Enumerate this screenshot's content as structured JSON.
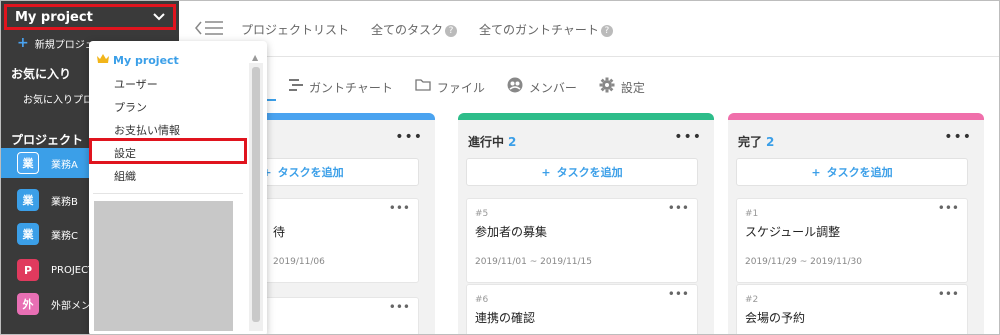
{
  "sidebar": {
    "project_title": "My project",
    "new_project_label": "新規プロジェ",
    "favorites_label": "お気に入り",
    "favorite_item": "お気に入りプロジ",
    "projects_label": "プロジェクト",
    "projects": [
      {
        "badge": "業",
        "name": "業務A",
        "color": "#3b9fe8"
      },
      {
        "badge": "業",
        "name": "業務B",
        "color": "#3b9fe8"
      },
      {
        "badge": "業",
        "name": "業務C",
        "color": "#3b9fe8"
      },
      {
        "badge": "P",
        "name": "PROJECT@",
        "color": "#e03a5e"
      },
      {
        "badge": "外",
        "name": "外部メンバ",
        "color": "#e86fb4"
      }
    ]
  },
  "topbar": {
    "nav": [
      "プロジェクトリスト",
      "全てのタスク",
      "全てのガントチャート"
    ]
  },
  "subtabs": [
    "ガントチャート",
    "ファイル",
    "メンバー",
    "設定"
  ],
  "dropdown": {
    "header": "My project",
    "items": [
      "ユーザー",
      "プラン",
      "お支払い情報",
      "設定",
      "組織"
    ]
  },
  "board": {
    "add_label": "タスクを追加",
    "columns": [
      {
        "title": "",
        "count": "",
        "color": "#4aa3f0",
        "cards": [
          {
            "num": "",
            "title": "待",
            "date": "2019/11/06"
          }
        ]
      },
      {
        "title": "進行中",
        "count": "2",
        "color": "#2dbd8a",
        "cards": [
          {
            "num": "#5",
            "title": "参加者の募集",
            "date": "2019/11/01 ~ 2019/11/15"
          },
          {
            "num": "#6",
            "title": "連携の確認",
            "date": ""
          }
        ]
      },
      {
        "title": "完了",
        "count": "2",
        "color": "#f06fab",
        "cards": [
          {
            "num": "#1",
            "title": "スケジュール調整",
            "date": "2019/11/29 ~ 2019/11/30"
          },
          {
            "num": "#2",
            "title": "会場の予約",
            "date": ""
          }
        ]
      }
    ]
  }
}
